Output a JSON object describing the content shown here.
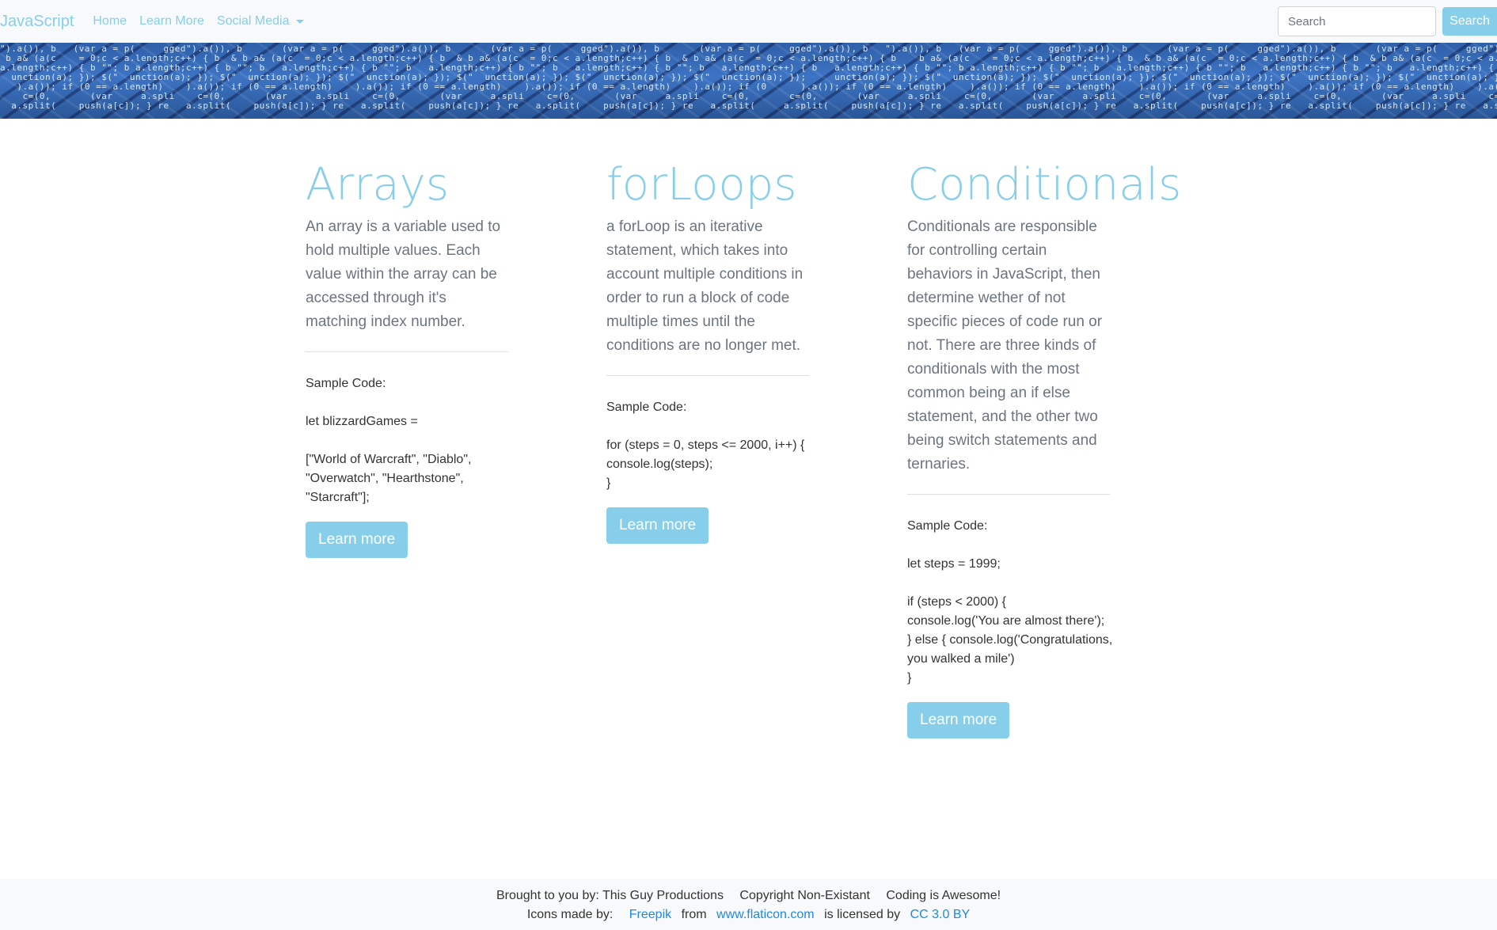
{
  "nav": {
    "brand": "JavaScript",
    "links": [
      "Home",
      "Learn More",
      "Social Media"
    ],
    "search_placeholder": "Search",
    "search_button": "Search"
  },
  "banner": {
    "code_lines": [
      "\").a()), b   (var a = p(     gged\").a()), b       (var a = p(     gged\").a()), b       (var a = p(     gged\").a()), b       (var a = p(     gged\").a()), b",
      " b a& (a(c    = 0;c < a.length;c++) { b  & b a& (a(c  = 0;c < a.length;c++) { b  & b a& (a(c  = 0;c < a.length;c++) { b  & b a& (a(c  = 0;c < a.length;c++) { b",
      "a.length;c++) { b \"\"; b a.length;c++) { b \"\"; b   a.length;c++) { b \"\"; b   a.length;c++) { b \"\"; b   a.length;c++) { b \"\"; b   a.length;c++) { b",
      "  unction(a); }); $(\"  unction(a); }); $(\"  unction(a); }); $(\"  unction(a); }); $(\"  unction(a); }); $(\"  unction(a); }); $(\"  unction(a); });",
      "   ).a()); if (0 == a.length)    ).a()); if (0 == a.length)    ).a()); if (0 == a.length)    ).a()); if (0 == a.length)    ).a()); if (0",
      "    c=(0,       (var     a.spli    c=(0,       (var     a.spli    c=(0,       (var     a.spli    c=(0,       (var     a.spli    c=(0,",
      "  a.split(    push(a[c]); } re   a.split(    push(a[c]); } re   a.split(    push(a[c]); } re   a.split(    push(a[c]); } re   a.split("
    ]
  },
  "columns": [
    {
      "title": "Arrays",
      "description": "An array is a variable used to hold multiple values. Each value within the array can be accessed through it's matching index number.",
      "sample_label": "Sample Code:",
      "code": [
        "let blizzardGames =",
        "",
        "[\"World of Warcraft\", \"Diablo\", \"Overwatch\", \"Hearthstone\", \"Starcraft\"];"
      ],
      "button": "Learn more"
    },
    {
      "title": "forLoops",
      "description": "a forLoop is an iterative statement, which takes into account multiple conditions in order to run a block of code multiple times until the conditions are no longer met.",
      "sample_label": "Sample Code:",
      "code": [
        "for (steps = 0, steps <= 2000, i++) {\nconsole.log(steps);\n}"
      ],
      "button": "Learn more"
    },
    {
      "title": "Conditionals",
      "description": "Conditionals are responsible for controlling certain behaviors in JavaScript, then determine wether of not specific pieces of code run or not. There are three kinds of conditionals with the most common being an if else statement, and the other two being switch statements and ternaries.",
      "sample_label": "Sample Code:",
      "code": [
        "let steps = 1999;",
        "",
        "if (steps < 2000) {\nconsole.log('You are almost there');\n} else { console.log('Congratulations, you walked a mile')\n}"
      ],
      "button": "Learn more"
    }
  ],
  "footer": {
    "line1": [
      "Brought to you by: This Guy Productions",
      "Copyright Non-Existant",
      "Coding is Awesome!"
    ],
    "icons_prefix": "Icons made by:",
    "freepik": "Freepik",
    "from": "from",
    "flaticon": "www.flaticon.com",
    "licensed": "is licensed by",
    "license": "CC 3.0 BY"
  },
  "colors": {
    "accent": "#87ceeb",
    "link": "#1e88e5",
    "navbar_bg": "#f8f9fa",
    "banner_blue": "#3d74c4"
  }
}
